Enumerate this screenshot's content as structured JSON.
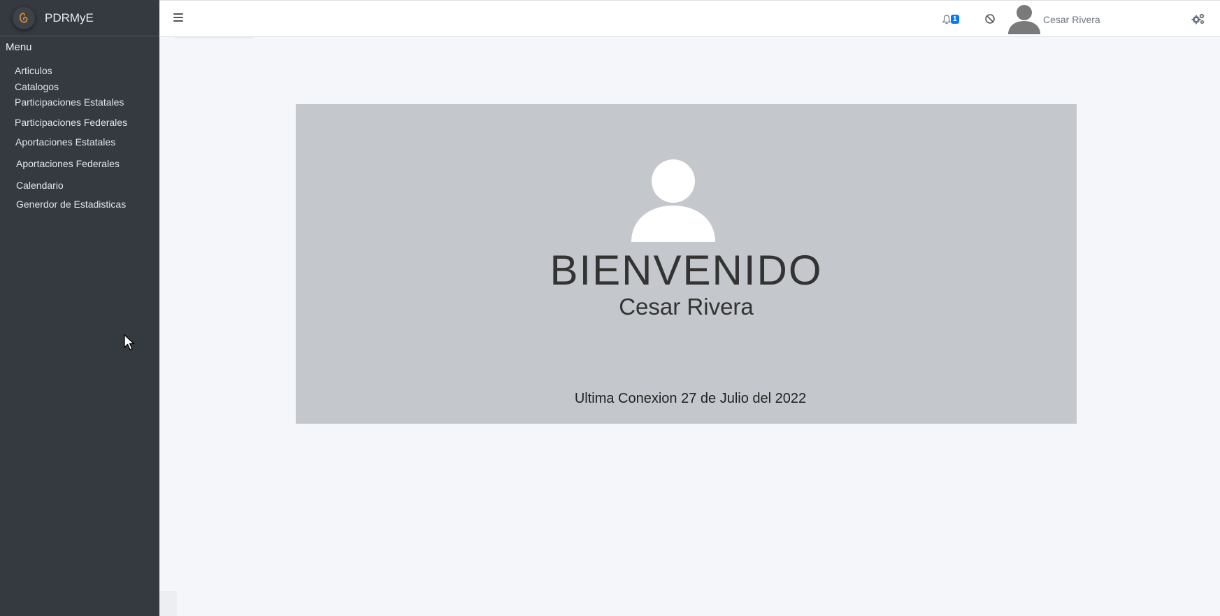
{
  "brand": {
    "name": "PDRMyE"
  },
  "sidebar": {
    "header": "Menu",
    "items": [
      {
        "label": "Articulos"
      },
      {
        "label": "Catalogos"
      },
      {
        "label": "Participaciones Estatales"
      },
      {
        "label": "Participaciones Federales"
      },
      {
        "label": "Aportaciones Estatales"
      },
      {
        "label": "Aportaciones Federales"
      },
      {
        "label": "Calendario"
      },
      {
        "label": "Generdor de Estadisticas"
      }
    ]
  },
  "navbar": {
    "notifications_count": "1",
    "user_name": "Cesar Rivera",
    "icons": [
      "menu-icon",
      "bell-icon",
      "ban-icon",
      "user-avatar-icon",
      "gears-icon"
    ]
  },
  "welcome_card": {
    "title": "BIENVENIDO",
    "user_name": "Cesar Rivera",
    "last_connection": "Ultima Conexion 27 de Julio del 2022"
  },
  "colors": {
    "sidebar_bg": "#343a40",
    "navbar_bg": "#ffffff",
    "content_bg": "#f4f6f9",
    "card_bg": "#c4c7cb",
    "badge": "#007bff"
  }
}
